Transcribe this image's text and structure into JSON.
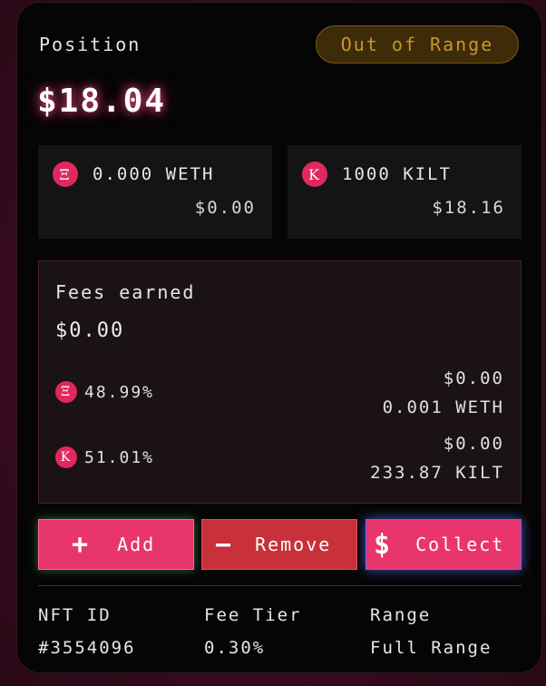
{
  "position": {
    "title": "Position",
    "status_badge": "Out of Range",
    "total_value": "$18.04"
  },
  "tokens": [
    {
      "symbol_glyph": "Ξ",
      "icon": "eth-icon",
      "amount": "0.000 WETH",
      "usd": "$0.00"
    },
    {
      "symbol_glyph": "K",
      "icon": "kilt-icon",
      "amount": "1000 KILT",
      "usd": "$18.16"
    }
  ],
  "fees": {
    "title": "Fees earned",
    "total": "$0.00",
    "rows": [
      {
        "symbol_glyph": "Ξ",
        "icon": "eth-icon",
        "percent": "48.99%",
        "usd": "$0.00",
        "amount": "0.001 WETH"
      },
      {
        "symbol_glyph": "K",
        "icon": "kilt-icon",
        "percent": "51.01%",
        "usd": "$0.00",
        "amount": "233.87 KILT"
      }
    ]
  },
  "actions": {
    "add": {
      "icon_glyph": "+",
      "label": "Add"
    },
    "remove": {
      "icon_glyph": "−",
      "label": "Remove"
    },
    "collect": {
      "icon_glyph": "$",
      "label": "Collect"
    }
  },
  "details": {
    "nft_id_label": "NFT ID",
    "nft_id_value": "#3554096",
    "fee_tier_label": "Fee Tier",
    "fee_tier_value": "0.30%",
    "range_label": "Range",
    "range_value": "Full Range"
  },
  "colors": {
    "accent": "#e8356d",
    "remove": "#c8303a",
    "badge_text": "#c9952a",
    "badge_bg": "#3d2b0a"
  }
}
